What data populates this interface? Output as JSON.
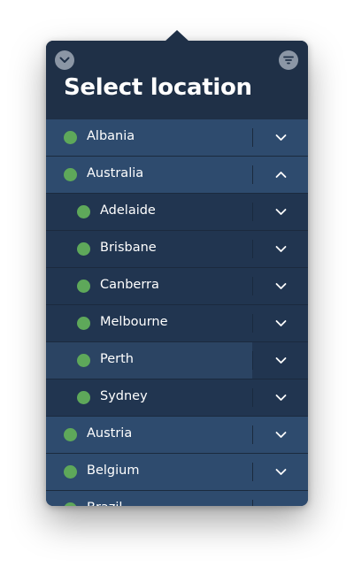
{
  "header": {
    "title": "Select location",
    "left_button_icon": "chevron-down-icon",
    "right_button_icon": "filter-icon"
  },
  "colors": {
    "panel_bg": "#1f3047",
    "country_row_bg": "#2e4b6e",
    "city_row_bg": "#213550",
    "city_row_hover_bg": "#2b4463",
    "status_dot": "#5ea85a",
    "text": "#ffffff"
  },
  "locations": [
    {
      "label": "Albania",
      "level": "country",
      "expanded": false
    },
    {
      "label": "Australia",
      "level": "country",
      "expanded": true
    },
    {
      "label": "Adelaide",
      "level": "city",
      "expanded": false
    },
    {
      "label": "Brisbane",
      "level": "city",
      "expanded": false
    },
    {
      "label": "Canberra",
      "level": "city",
      "expanded": false
    },
    {
      "label": "Melbourne",
      "level": "city",
      "expanded": false
    },
    {
      "label": "Perth",
      "level": "city",
      "expanded": false,
      "hovered": true
    },
    {
      "label": "Sydney",
      "level": "city",
      "expanded": false
    },
    {
      "label": "Austria",
      "level": "country",
      "expanded": false
    },
    {
      "label": "Belgium",
      "level": "country",
      "expanded": false
    },
    {
      "label": "Brazil",
      "level": "country",
      "expanded": false
    }
  ]
}
